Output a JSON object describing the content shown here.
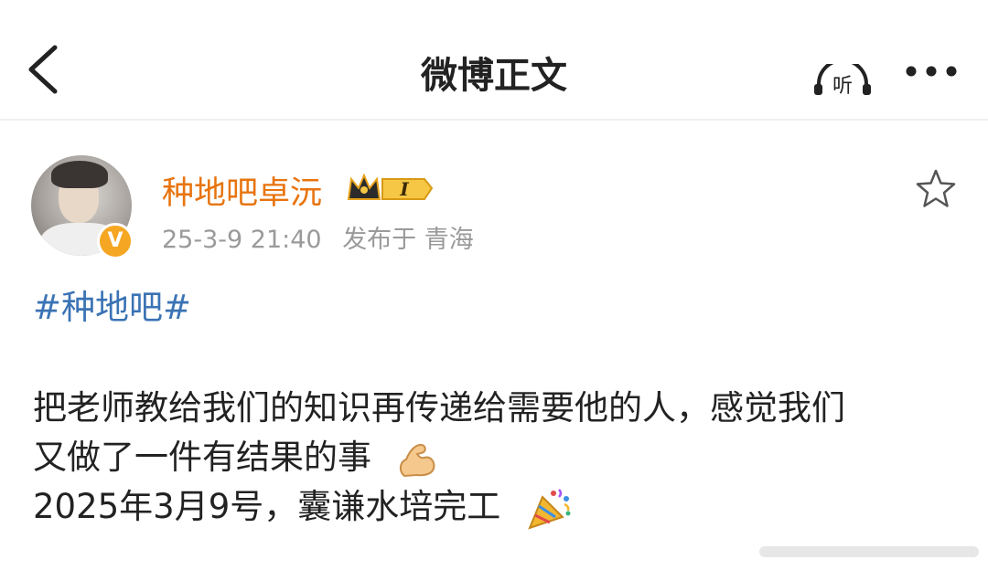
{
  "header": {
    "title": "微博正文",
    "back_icon": "chevron-left-icon",
    "listen_label": "听",
    "more_icon": "more-dots-icon"
  },
  "post": {
    "author": "种地吧卓沅",
    "verified_badge": "V",
    "crown_level": "I",
    "date": "25-3-9 21:40",
    "location": "发布于 青海",
    "favorite_icon": "star-outline-icon",
    "hashtag": "#种地吧#",
    "lines": [
      "把老师教给我们的知识再传递给需要他的人，感觉我们",
      "又做了一件有结果的事",
      "2025年3月9号，囊谦水培完工"
    ],
    "emojis": [
      "flexed-biceps-icon",
      "party-popper-icon"
    ]
  },
  "colors": {
    "username": "#e8740f",
    "hashtag": "#3b73b5",
    "meta": "#9a9a9a",
    "badge": "#f5a623"
  }
}
